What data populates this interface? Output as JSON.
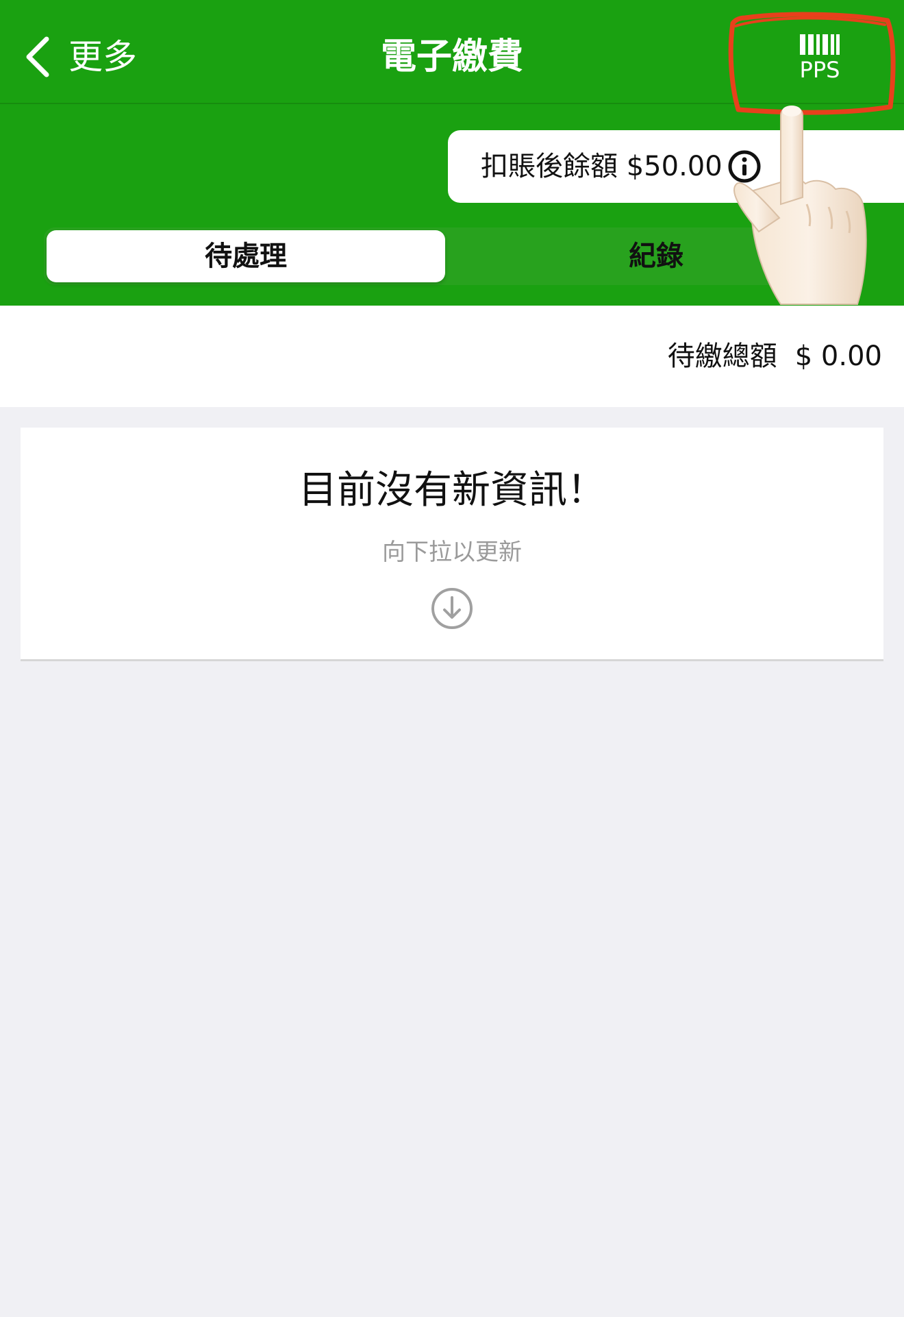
{
  "nav": {
    "back_label": "更多",
    "title": "電子繳費",
    "pps_label": "PPS"
  },
  "balance": {
    "label": "扣賬後餘額",
    "amount": "$50.00"
  },
  "tabs": [
    {
      "label": "待處理",
      "selected": true
    },
    {
      "label": "紀錄",
      "selected": false
    }
  ],
  "total": {
    "label": "待繳總額",
    "amount": "$ 0.00"
  },
  "empty_state": {
    "title": "目前沒有新資訊！",
    "subtitle": "向下拉以更新"
  },
  "colors": {
    "header_green": "#1aa111",
    "annotation_red": "#e8401c"
  },
  "icons": {
    "back": "chevron-left-icon",
    "pps": "barcode-icon",
    "info": "info-circle-icon",
    "refresh": "arrow-down-circle-icon",
    "annotation": "pointing-hand-icon"
  }
}
